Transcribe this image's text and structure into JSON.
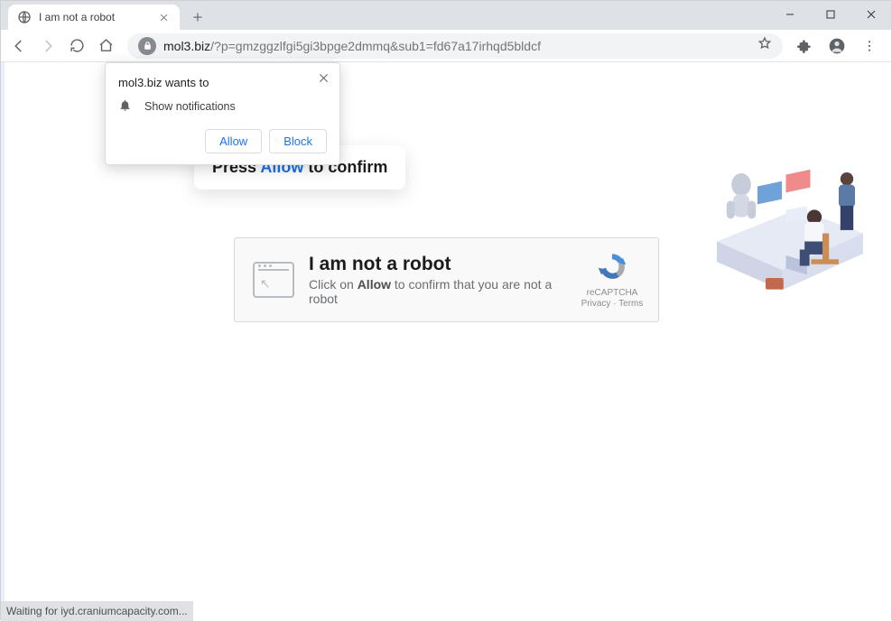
{
  "window": {
    "minimize": "–",
    "maximize": "▢",
    "close": "✕"
  },
  "tab": {
    "title": "I am not a robot"
  },
  "address": {
    "domain": "mol3.biz",
    "path": "/?p=gmzggzlfgi5gi3bpge2dmmq&sub1=fd67a17irhqd5bldcf"
  },
  "permission": {
    "title": "mol3.biz wants to",
    "item": "Show notifications",
    "allow": "Allow",
    "block": "Block"
  },
  "press_card": {
    "pre": "Press ",
    "allow": "Allow",
    "post": " to confirm"
  },
  "captcha": {
    "heading": "I am not a robot",
    "line_pre": "Click on ",
    "line_bold": "Allow",
    "line_post": " to confirm that you are not a robot",
    "brand": "reCAPTCHA",
    "links": "Privacy · Terms"
  },
  "status": "Waiting for iyd.craniumcapacity.com..."
}
